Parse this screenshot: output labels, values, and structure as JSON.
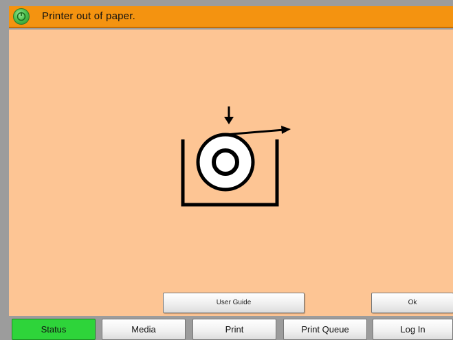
{
  "status_bar": {
    "message": "Printer out of paper.",
    "status_icon": "power-status-icon",
    "color": "#f49310"
  },
  "main": {
    "illustration": "paper-roll-out-icon",
    "background": "#fdc594"
  },
  "actions": {
    "user_guide_label": "User Guide",
    "ok_label": "Ok"
  },
  "tabs": [
    {
      "label": "Status",
      "active": true
    },
    {
      "label": "Media",
      "active": false
    },
    {
      "label": "Print",
      "active": false
    },
    {
      "label": "Print Queue",
      "active": false
    },
    {
      "label": "Log In",
      "active": false
    }
  ],
  "colors": {
    "active_tab": "#2ed43a"
  }
}
